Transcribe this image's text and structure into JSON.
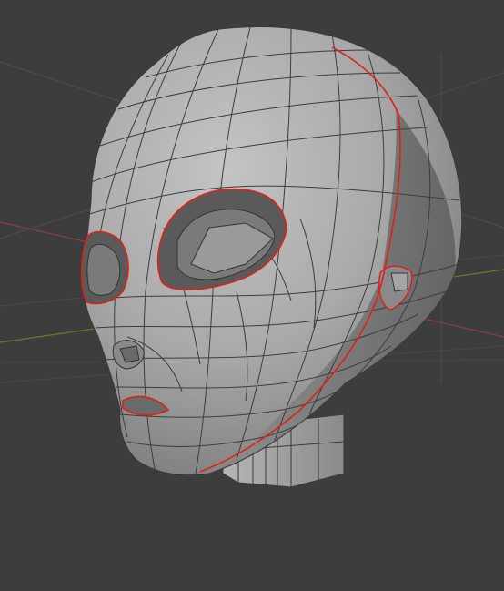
{
  "viewport": {
    "colors": {
      "background": "#3d3d3d",
      "grid_line": "#4a4a4a",
      "x_axis": "#8f3c44",
      "y_axis": "#5e7f2e",
      "mesh_light": "#b9b9b9",
      "mesh_mid": "#9a9a9a",
      "mesh_dark": "#6e6e6e",
      "wire": "#3a3a3a",
      "seam": "#e0201c"
    },
    "object": {
      "icon": "mesh-head",
      "mode": "edit",
      "seams_marked": true
    }
  }
}
